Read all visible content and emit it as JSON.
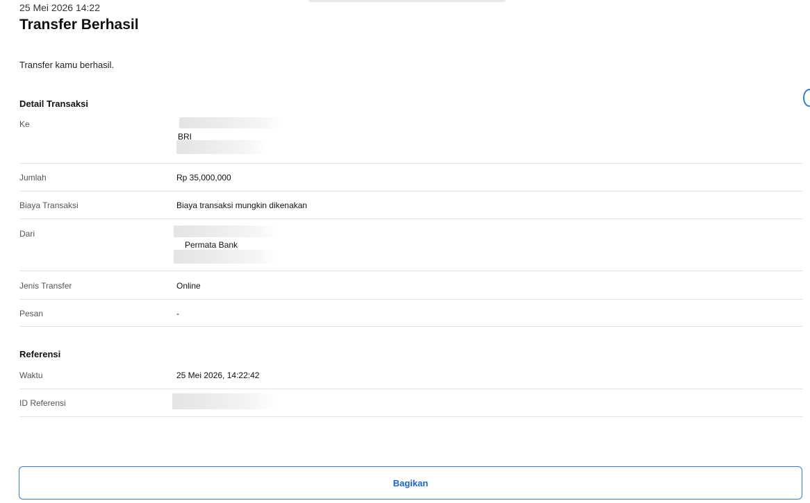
{
  "header": {
    "datetime": "25 Mei 2026 14:22",
    "title": "Transfer Berhasil",
    "message": "Transfer kamu berhasil."
  },
  "detail": {
    "section_title": "Detail Transaksi",
    "to_label": "Ke",
    "to_bank": "BRI",
    "amount_label": "Jumlah",
    "amount_value": "Rp 35,000,000",
    "fee_label": "Biaya Transaksi",
    "fee_value": "Biaya transaksi mungkin dikenakan",
    "from_label": "Dari",
    "from_bank": "Permata Bank",
    "type_label": "Jenis Transfer",
    "type_value": "Online",
    "message_label": "Pesan",
    "message_value": "-"
  },
  "reference": {
    "section_title": "Referensi",
    "time_label": "Waktu",
    "time_value": "25 Mei 2026, 14:22:42",
    "id_label": "ID Referensi"
  },
  "actions": {
    "share_label": "Bagikan"
  },
  "colors": {
    "accent": "#2f7de1",
    "button_text": "#1565d8",
    "divider": "#e2e2e2"
  }
}
